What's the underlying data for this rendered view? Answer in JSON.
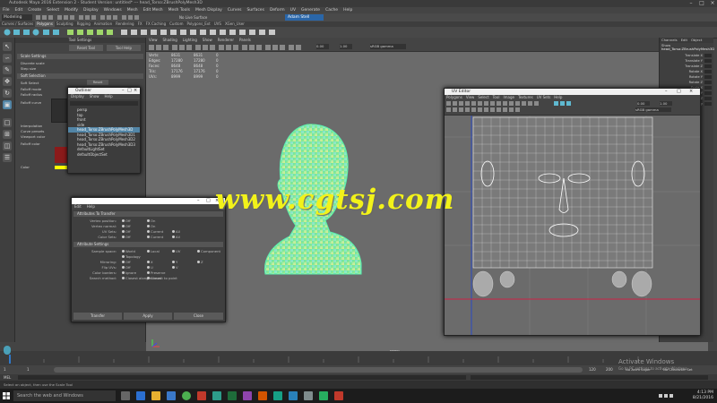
{
  "app": {
    "title": "Autodesk Maya 2016 Extension 2 - Student Version: untitled* --- head_Torso:ZBrushPolyMesh3D",
    "menus": [
      "File",
      "Edit",
      "Create",
      "Select",
      "Modify",
      "Display",
      "Windows",
      "Mesh",
      "Edit Mesh",
      "Mesh Tools",
      "Mesh Display",
      "Curves",
      "Surfaces",
      "Deform",
      "UV",
      "Generate",
      "Cache",
      "Help"
    ]
  },
  "status_line": {
    "mode": "Modeling",
    "live": "No Live Surface",
    "user": "Adam Stell"
  },
  "shelf": {
    "tabs": [
      "Curves / Surfaces",
      "Polygons",
      "Sculpting",
      "Rigging",
      "Animation",
      "Rendering",
      "FX",
      "FX Caching",
      "Custom",
      "Polygons_Ext",
      "UVS",
      "XGen_User"
    ],
    "active": "Polygons"
  },
  "attr_editor": {
    "title": "Tool Settings",
    "buttons": [
      "Reset Tool",
      "Tool Help"
    ],
    "sections": [
      "Scale Settings",
      "Soft Selection"
    ],
    "fields": [
      "Discrete scale",
      "Step size",
      "Soft Select",
      "Falloff mode",
      "Falloff radius",
      "Falloff curve",
      "Interpolation",
      "Curve presets",
      "Viewport color",
      "Falloff color",
      "Color"
    ],
    "reset_label": "Reset"
  },
  "viewport": {
    "menus": [
      "View",
      "Shading",
      "Lighting",
      "Show",
      "Renderer",
      "Panels"
    ],
    "hud": [
      {
        "label": "Verts:",
        "a": "8631",
        "b": "8631",
        "c": "0"
      },
      {
        "label": "Edges:",
        "a": "17280",
        "b": "17280",
        "c": "0"
      },
      {
        "label": "Faces:",
        "a": "8648",
        "b": "8648",
        "c": "0"
      },
      {
        "label": "Tris:",
        "a": "17176",
        "b": "17176",
        "c": "0"
      },
      {
        "label": "UVs:",
        "a": "8999",
        "b": "8999",
        "c": "0"
      }
    ],
    "exposure": "0.00",
    "gamma": "1.00",
    "colorspace": "sRGB gamma",
    "camera": "persp"
  },
  "outliner": {
    "title": "Outliner",
    "menus": [
      "Display",
      "Show",
      "Help"
    ],
    "items": [
      "persp",
      "top",
      "front",
      "side",
      "head_Torso:ZBrushPolyMesh3D",
      "head_Torso:ZBrushPolyMesh3D1",
      "head_Torso:ZBrushPolyMesh3D2",
      "head_Torso:ZBrushPolyMesh3D3",
      "defaultLightSet",
      "defaultObjectSet"
    ],
    "selected_index": 4
  },
  "transfer_attrs": {
    "menus": [
      "Edit",
      "Help"
    ],
    "sections": [
      "Attributes To Transfer",
      "Attribute Settings"
    ],
    "rows": [
      {
        "label": "Vertex position:",
        "opts": [
          "Off",
          "On"
        ]
      },
      {
        "label": "Vertex normal:",
        "opts": [
          "Off",
          "On"
        ]
      },
      {
        "label": "UV Sets:",
        "opts": [
          "Off",
          "Current",
          "All"
        ]
      },
      {
        "label": "Color Sets:",
        "opts": [
          "Off",
          "Current",
          "All"
        ]
      }
    ],
    "settings": [
      {
        "label": "Sample space:",
        "opts": [
          "World",
          "Local",
          "UV",
          "Component"
        ]
      },
      {
        "label": "",
        "opts": [
          "Topology"
        ]
      },
      {
        "label": "Mirroring:",
        "opts": [
          "Off",
          "X",
          "Y",
          "Z"
        ]
      },
      {
        "label": "Flip UVs:",
        "opts": [
          "Off",
          "U",
          "V"
        ]
      },
      {
        "label": "Color borders:",
        "opts": [
          "Ignore",
          "Preserve"
        ]
      },
      {
        "label": "Search method:",
        "opts": [
          "Closest along normal",
          "Closest to point"
        ]
      }
    ],
    "buttons": [
      "Transfer",
      "Apply",
      "Close"
    ]
  },
  "uv_editor": {
    "title": "UV Editor",
    "menus": [
      "Polygons",
      "View",
      "Select",
      "Tool",
      "Image",
      "Textures",
      "UV Sets",
      "Help"
    ],
    "exposure": "0.00",
    "gamma": "1.00",
    "colorspace": "sRGB gamma"
  },
  "right_panel": {
    "tabs": [
      "Channels",
      "Edit",
      "Object",
      "Show"
    ],
    "object": "head_Torso:ZBrushPolyMesh3D",
    "channels": [
      "Translate X",
      "Translate Y",
      "Translate Z",
      "Rotate X",
      "Rotate Y",
      "Rotate Z",
      "Scale X",
      "Scale Y",
      "Scale Z",
      "Visibility"
    ]
  },
  "timeline": {
    "start": "1",
    "end": "120",
    "current": "1",
    "range_end": "200",
    "anim_layer": "No Anim Layer",
    "char_set": "No Character Set"
  },
  "command": {
    "lang": "MEL",
    "help": "Select an object, then use the Scale Tool"
  },
  "watermark": "www.cgtsj.com",
  "activation": {
    "line1": "Activate Windows",
    "line2": "Go to PC settings to activate Windows."
  },
  "taskbar": {
    "search": "Search the web and Windows",
    "time": "4:13 PM",
    "date": "8/21/2016"
  },
  "colors": {
    "selection": "#5285a6",
    "mesh": "#40e0a0",
    "watermark": "#f2f21a",
    "falloff": "#ffff00"
  }
}
